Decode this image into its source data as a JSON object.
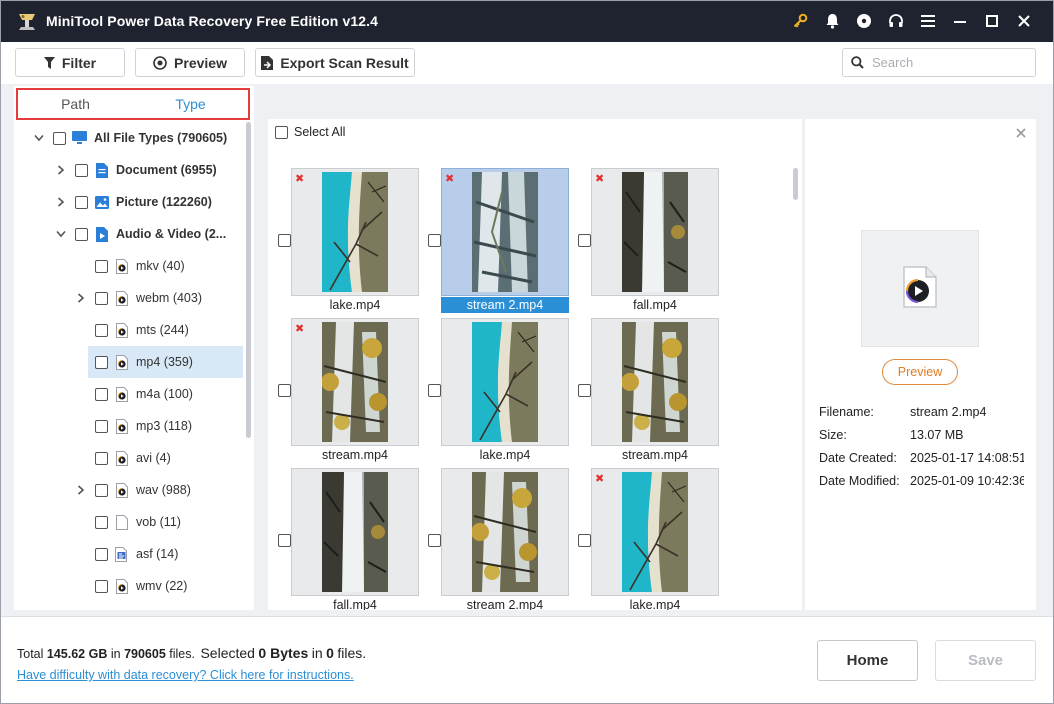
{
  "window": {
    "title": "MiniTool Power Data Recovery Free Edition v12.4",
    "icons": [
      "key-icon",
      "bell-icon",
      "disc-icon",
      "headset-icon",
      "menu-icon",
      "minimize-icon",
      "maximize-icon",
      "close-icon"
    ]
  },
  "toolbar": {
    "filter_label": "Filter",
    "preview_label": "Preview",
    "export_label": "Export Scan Result",
    "search_placeholder": "Search"
  },
  "tabs": [
    {
      "label": "Path",
      "active": false
    },
    {
      "label": "Type",
      "active": true
    }
  ],
  "tree": [
    {
      "label": "All File Types (790605)",
      "level": 0,
      "expander": "expanded",
      "icon": "monitor-icon",
      "bold": true,
      "selected": false
    },
    {
      "label": "Document (6955)",
      "level": 1,
      "expander": "collapsed",
      "icon": "document-icon",
      "bold": true,
      "selected": false
    },
    {
      "label": "Picture (122260)",
      "level": 1,
      "expander": "collapsed",
      "icon": "picture-icon",
      "bold": true,
      "selected": false
    },
    {
      "label": "Audio & Video (2...",
      "level": 1,
      "expander": "expanded",
      "icon": "media-icon",
      "bold": true,
      "selected": false
    },
    {
      "label": "mkv (40)",
      "level": 2,
      "expander": "none",
      "icon": "video-file-icon",
      "bold": false,
      "selected": false
    },
    {
      "label": "webm (403)",
      "level": 2,
      "expander": "collapsed",
      "icon": "video-file-icon",
      "bold": false,
      "selected": false
    },
    {
      "label": "mts (244)",
      "level": 2,
      "expander": "none",
      "icon": "video-file-icon",
      "bold": false,
      "selected": false
    },
    {
      "label": "mp4 (359)",
      "level": 2,
      "expander": "none",
      "icon": "video-file-icon",
      "bold": false,
      "selected": true
    },
    {
      "label": "m4a (100)",
      "level": 2,
      "expander": "none",
      "icon": "video-file-icon",
      "bold": false,
      "selected": false
    },
    {
      "label": "mp3 (118)",
      "level": 2,
      "expander": "none",
      "icon": "video-file-icon",
      "bold": false,
      "selected": false
    },
    {
      "label": "avi (4)",
      "level": 2,
      "expander": "none",
      "icon": "video-file-icon",
      "bold": false,
      "selected": false
    },
    {
      "label": "wav (988)",
      "level": 2,
      "expander": "collapsed",
      "icon": "video-file-icon",
      "bold": false,
      "selected": false
    },
    {
      "label": "vob (11)",
      "level": 2,
      "expander": "none",
      "icon": "blank-file-icon",
      "bold": false,
      "selected": false
    },
    {
      "label": "asf (14)",
      "level": 2,
      "expander": "none",
      "icon": "asf-file-icon",
      "bold": false,
      "selected": false
    },
    {
      "label": "wmv (22)",
      "level": 2,
      "expander": "none",
      "icon": "video-file-icon",
      "bold": false,
      "selected": false
    }
  ],
  "grid": {
    "select_all_label": "Select All",
    "items": [
      {
        "name": "lake.mp4",
        "scene": "lake",
        "deleted": true,
        "selected": false
      },
      {
        "name": "stream 2.mp4",
        "scene": "stream",
        "deleted": true,
        "selected": true
      },
      {
        "name": "fall.mp4",
        "scene": "fall",
        "deleted": true,
        "selected": false
      },
      {
        "name": "stream.mp4",
        "scene": "stream-yellow",
        "deleted": true,
        "selected": false
      },
      {
        "name": "lake.mp4",
        "scene": "lake",
        "deleted": false,
        "selected": false
      },
      {
        "name": "stream.mp4",
        "scene": "stream-yellow",
        "deleted": false,
        "selected": false
      },
      {
        "name": "fall.mp4",
        "scene": "fall",
        "deleted": false,
        "selected": false
      },
      {
        "name": "stream 2.mp4",
        "scene": "stream-yellow",
        "deleted": false,
        "selected": false
      },
      {
        "name": "lake.mp4",
        "scene": "lake",
        "deleted": true,
        "selected": false
      }
    ]
  },
  "details": {
    "preview_button": "Preview",
    "rows": [
      {
        "key": "Filename:",
        "value": "stream 2.mp4"
      },
      {
        "key": "Size:",
        "value": "13.07 MB"
      },
      {
        "key": "Date Created:",
        "value": "2025-01-17 14:08:51"
      },
      {
        "key": "Date Modified:",
        "value": "2025-01-09 10:42:36"
      }
    ]
  },
  "footer": {
    "total_prefix": "Total",
    "total_size": "145.62 GB",
    "in_word": "in",
    "total_files": "790605",
    "files_word": "files.",
    "selected_prefix": "Selected",
    "selected_size": "0 Bytes",
    "selected_in": "in",
    "selected_files": "0",
    "selected_suffix": "files.",
    "help_link": "Have difficulty with data recovery? Click here for instructions.",
    "home_label": "Home",
    "save_label": "Save"
  },
  "colors": {
    "titlebar": "#1f2330",
    "accent": "#2b8fd6",
    "highlight_border": "#e63b3b",
    "preview_button": "#e07b22",
    "deleted_mark": "#e53030"
  }
}
